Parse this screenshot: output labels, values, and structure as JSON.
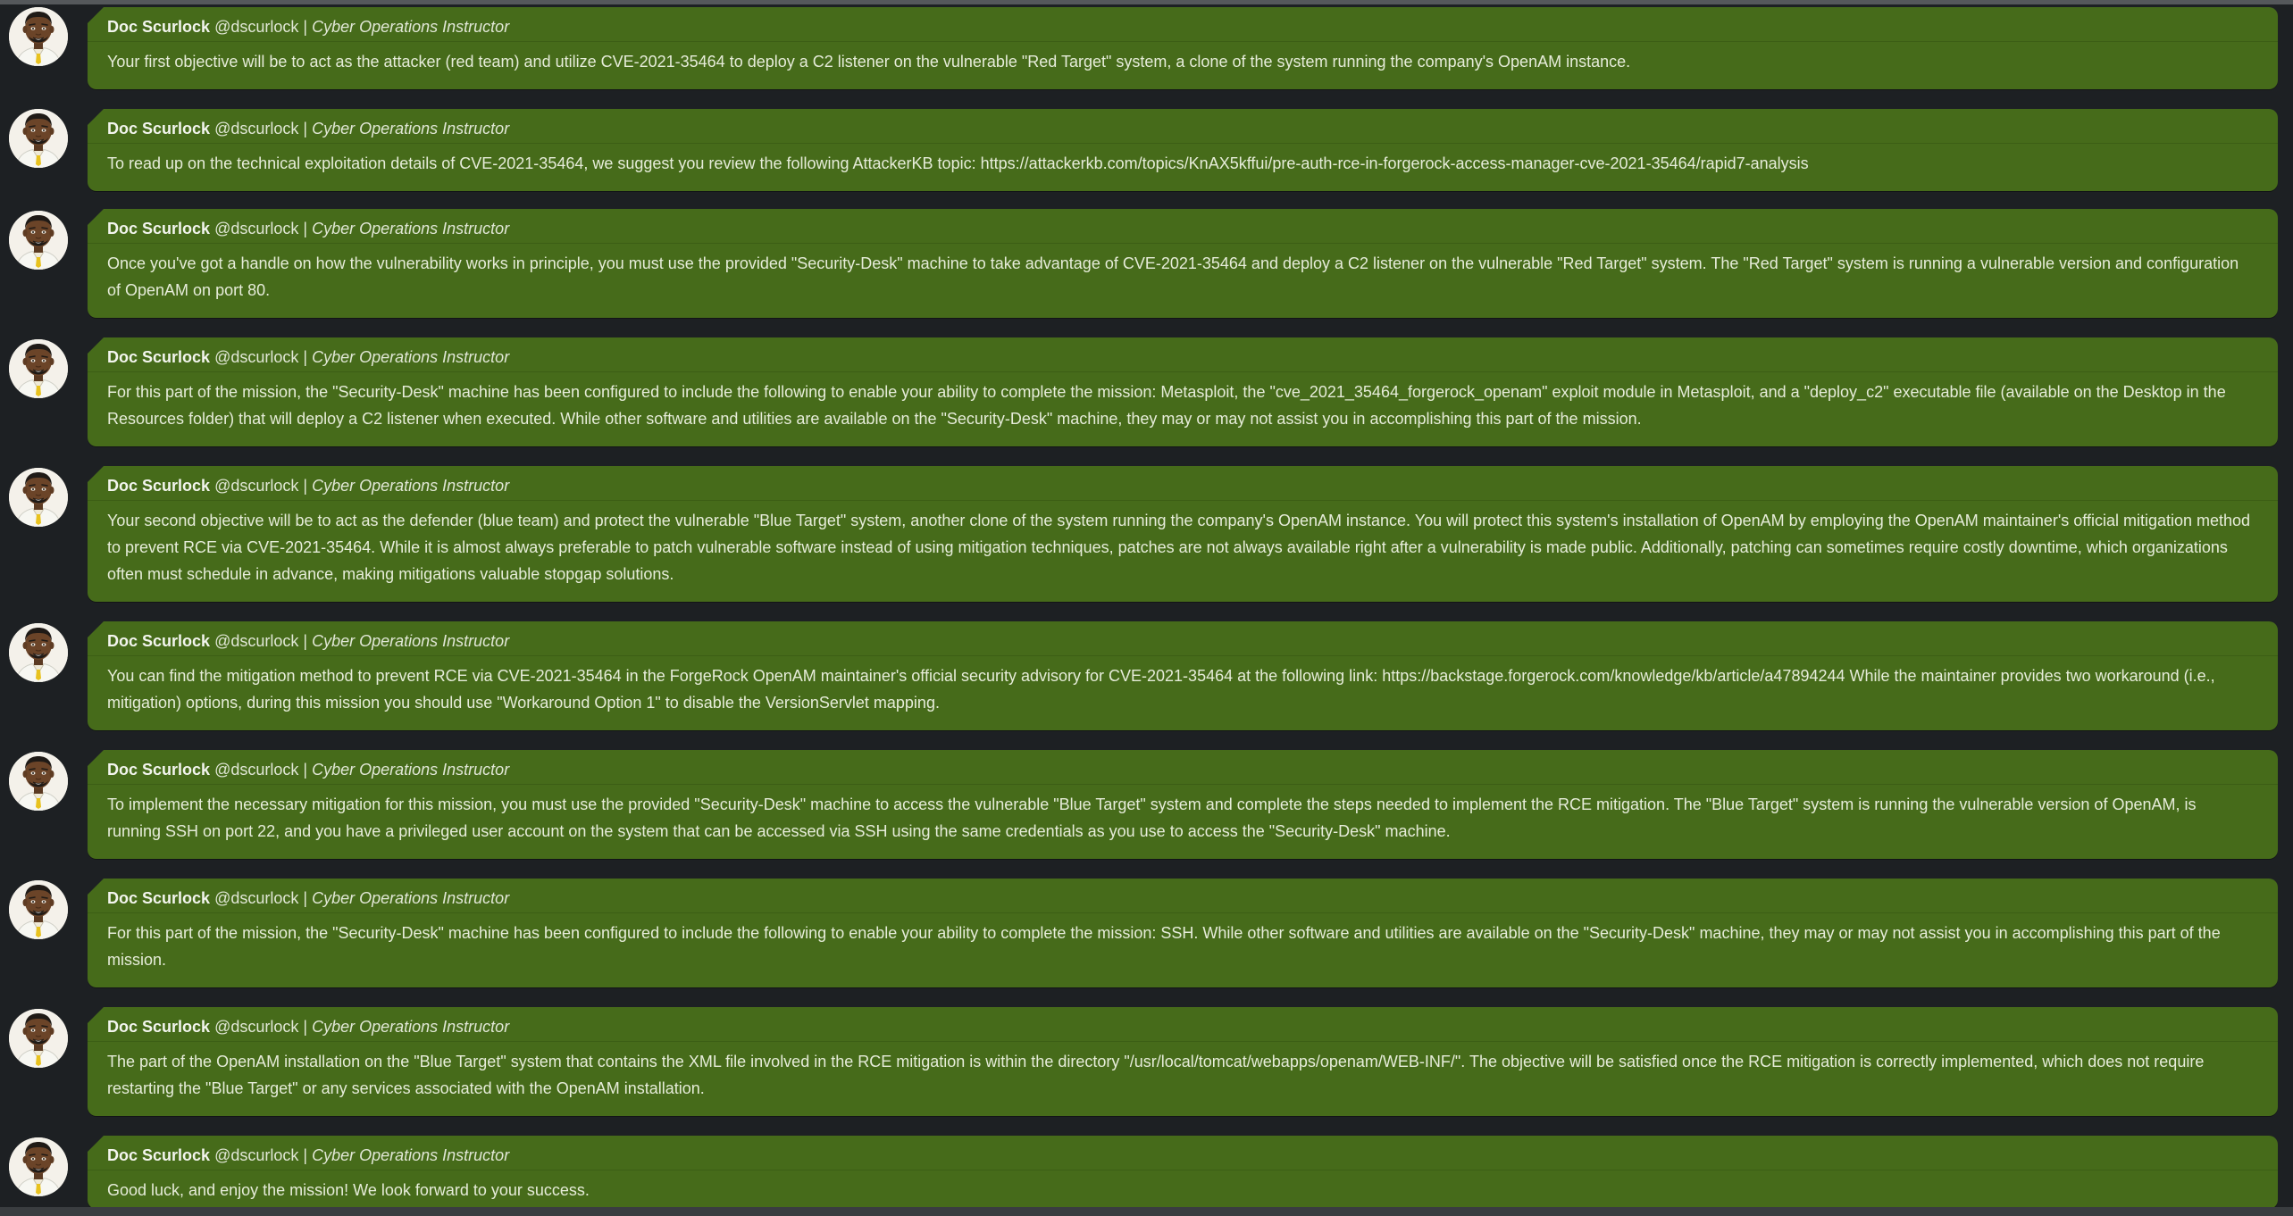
{
  "author": {
    "name": "Doc Scurlock",
    "handle": "@dscurlock",
    "separator": "|",
    "role": "Cyber Operations Instructor"
  },
  "messages": [
    {
      "text": "Your first objective will be to act as the attacker (red team) and utilize CVE-2021-35464 to deploy a C2 listener on the vulnerable \"Red Target\" system, a clone of the system running the company's OpenAM instance."
    },
    {
      "text": "To read up on the technical exploitation details of CVE-2021-35464, we suggest you review the following AttackerKB topic: https://attackerkb.com/topics/KnAX5kffui/pre-auth-rce-in-forgerock-access-manager-cve-2021-35464/rapid7-analysis"
    },
    {
      "text": "Once you've got a handle on how the vulnerability works in principle, you must use the provided \"Security-Desk\" machine to take advantage of CVE-2021-35464 and deploy a C2 listener on the vulnerable \"Red Target\" system. The \"Red Target\" system is running a vulnerable version and configuration of OpenAM on port 80."
    },
    {
      "text": "For this part of the mission, the \"Security-Desk\" machine has been configured to include the following to enable your ability to complete the mission: Metasploit, the \"cve_2021_35464_forgerock_openam\" exploit module in Metasploit, and a \"deploy_c2\" executable file (available on the Desktop in the Resources folder) that will deploy a C2 listener when executed. While other software and utilities are available on the \"Security-Desk\" machine, they may or may not assist you in accomplishing this part of the mission."
    },
    {
      "text": "Your second objective will be to act as the defender (blue team) and protect the vulnerable \"Blue Target\" system, another clone of the system running the company's OpenAM instance. You will protect this system's installation of OpenAM by employing the OpenAM maintainer's official mitigation method to prevent RCE via CVE-2021-35464. While it is almost always preferable to patch vulnerable software instead of using mitigation techniques, patches are not always available right after a vulnerability is made public. Additionally, patching can sometimes require costly downtime, which organizations often must schedule in advance, making mitigations valuable stopgap solutions."
    },
    {
      "text": "You can find the mitigation method to prevent RCE via CVE-2021-35464 in the ForgeRock OpenAM maintainer's official security advisory for CVE-2021-35464 at the following link: https://backstage.forgerock.com/knowledge/kb/article/a47894244 While the maintainer provides two workaround (i.e., mitigation) options, during this mission you should use \"Workaround Option 1\" to disable the VersionServlet mapping."
    },
    {
      "text": "To implement the necessary mitigation for this mission, you must use the provided \"Security-Desk\" machine to access the vulnerable \"Blue Target\" system and complete the steps needed to implement the RCE mitigation. The \"Blue Target\" system is running the vulnerable version of OpenAM, is running SSH on port 22, and you have a privileged user account on the system that can be accessed via SSH using the same credentials as you use to access the \"Security-Desk\" machine."
    },
    {
      "text": "For this part of the mission, the \"Security-Desk\" machine has been configured to include the following to enable your ability to complete the mission: SSH. While other software and utilities are available on the \"Security-Desk\" machine, they may or may not assist you in accomplishing this part of the mission."
    },
    {
      "text": "The part of the OpenAM installation on the \"Blue Target\" system that contains the XML file involved in the RCE mitigation is within the directory \"/usr/local/tomcat/webapps/openam/WEB-INF/\". The objective will be satisfied once the RCE mitigation is correctly implemented, which does not require restarting the \"Blue Target\" or any services associated with the OpenAM installation."
    },
    {
      "text": "Good luck, and enjoy the mission! We look forward to your success."
    }
  ],
  "colors": {
    "background": "#1d2023",
    "bubble": "#466b1a",
    "text": "#e6ecd9"
  }
}
